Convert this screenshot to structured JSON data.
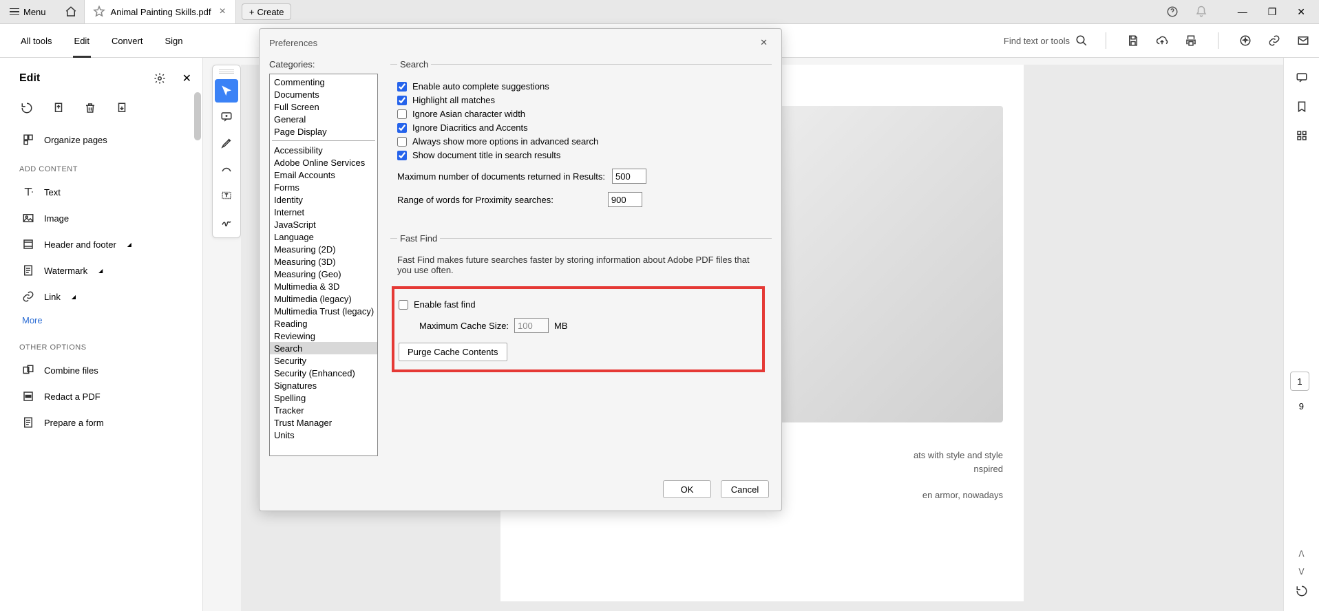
{
  "titlebar": {
    "menu": "Menu",
    "tab_title": "Animal Painting Skills.pdf",
    "create": "Create"
  },
  "secbar": {
    "all_tools": "All tools",
    "edit": "Edit",
    "convert": "Convert",
    "sign": "Sign",
    "find": "Find text or tools"
  },
  "leftpanel": {
    "title": "Edit",
    "organize": "Organize pages",
    "section_add": "ADD CONTENT",
    "text": "Text",
    "image": "Image",
    "header_footer": "Header and footer",
    "watermark": "Watermark",
    "link": "Link",
    "more": "More",
    "section_other": "OTHER OPTIONS",
    "combine": "Combine files",
    "redact": "Redact a PDF",
    "prepare": "Prepare a form"
  },
  "page_indicator": {
    "current": "1",
    "total": "9"
  },
  "doc_text": {
    "l1": "ats with style and style",
    "l2": "nspired",
    "l3": "en armor, nowadays"
  },
  "prefs": {
    "title": "Preferences",
    "categories_label": "Categories:",
    "categories_top": [
      "Commenting",
      "Documents",
      "Full Screen",
      "General",
      "Page Display"
    ],
    "categories_rest": [
      "Accessibility",
      "Adobe Online Services",
      "Email Accounts",
      "Forms",
      "Identity",
      "Internet",
      "JavaScript",
      "Language",
      "Measuring (2D)",
      "Measuring (3D)",
      "Measuring (Geo)",
      "Multimedia & 3D",
      "Multimedia (legacy)",
      "Multimedia Trust (legacy)",
      "Reading",
      "Reviewing",
      "Search",
      "Security",
      "Security (Enhanced)",
      "Signatures",
      "Spelling",
      "Tracker",
      "Trust Manager",
      "Units"
    ],
    "selected_category": "Search",
    "search": {
      "legend": "Search",
      "autocomplete": "Enable auto complete suggestions",
      "highlight": "Highlight all matches",
      "ignore_asian": "Ignore Asian character width",
      "ignore_diac": "Ignore Diacritics and Accents",
      "always_more": "Always show more options in advanced search",
      "show_title": "Show document title in search results",
      "max_docs_label": "Maximum number of documents returned in Results:",
      "max_docs_value": "500",
      "proximity_label": "Range of words for Proximity searches:",
      "proximity_value": "900"
    },
    "fastfind": {
      "legend": "Fast Find",
      "desc": "Fast Find makes future searches faster by storing information about Adobe PDF files that you use often.",
      "enable": "Enable fast find",
      "cache_label": "Maximum Cache Size:",
      "cache_value": "100",
      "cache_unit": "MB",
      "purge": "Purge Cache Contents"
    },
    "ok": "OK",
    "cancel": "Cancel"
  }
}
